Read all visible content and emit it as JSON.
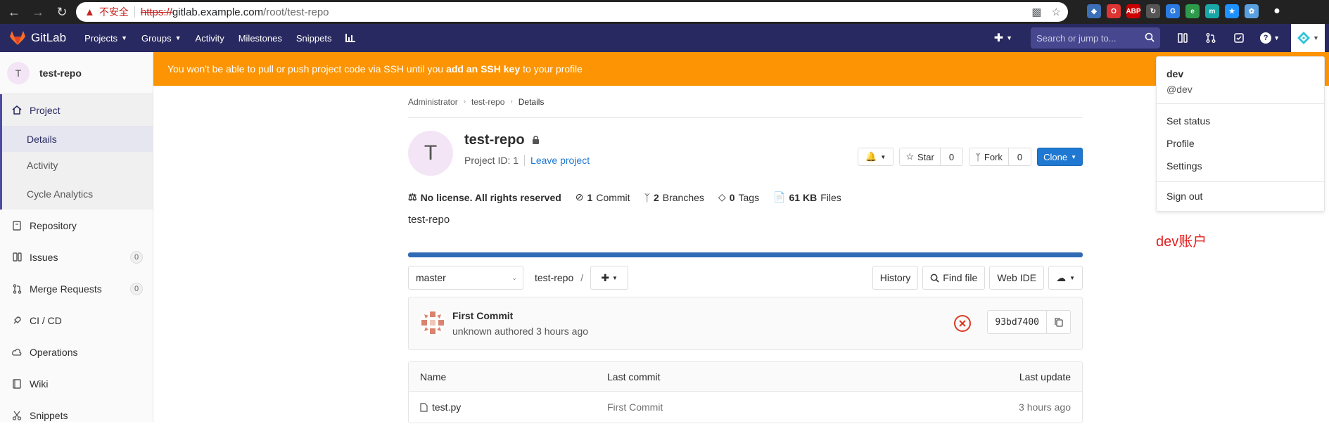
{
  "browser": {
    "insecure_label": "不安全",
    "url_scheme": "https://",
    "url_host": "gitlab.example.com",
    "url_path": "/root/test-repo"
  },
  "topnav": {
    "logo_text": "GitLab",
    "menu": [
      "Projects",
      "Groups",
      "Activity",
      "Milestones",
      "Snippets"
    ],
    "search_placeholder": "Search or jump to...",
    "brand_color": "#292961"
  },
  "banner": {
    "text_before": "You won't be able to pull or push project code via SSH until you",
    "link": "add an SSH key",
    "text_after": "to your profile",
    "color": "#fc9403"
  },
  "sidebar": {
    "project_initial": "T",
    "project_name": "test-repo",
    "section": "Project",
    "sub_items": [
      "Details",
      "Activity",
      "Cycle Analytics"
    ],
    "items": [
      {
        "label": "Repository"
      },
      {
        "label": "Issues",
        "count": "0"
      },
      {
        "label": "Merge Requests",
        "count": "0"
      },
      {
        "label": "CI / CD"
      },
      {
        "label": "Operations"
      },
      {
        "label": "Wiki"
      },
      {
        "label": "Snippets"
      }
    ]
  },
  "breadcrumb": [
    "Administrator",
    "test-repo",
    "Details"
  ],
  "project": {
    "initial": "T",
    "title": "test-repo",
    "project_id": "Project ID: 1",
    "leave": "Leave project",
    "star_label": "Star",
    "star_count": "0",
    "fork_label": "Fork",
    "fork_count": "0",
    "clone_label": "Clone",
    "description": "test-repo"
  },
  "stats": {
    "license": "No license. All rights reserved",
    "commits_n": "1",
    "commits_label": "Commit",
    "branches_n": "2",
    "branches_label": "Branches",
    "tags_n": "0",
    "tags_label": "Tags",
    "files_size": "61 KB",
    "files_label": "Files"
  },
  "toolbar": {
    "branch": "master",
    "path": "test-repo",
    "path_sep": "/",
    "history": "History",
    "find_file": "Find file",
    "web_ide": "Web IDE"
  },
  "commit": {
    "title": "First Commit",
    "meta": "unknown authored 3 hours ago",
    "sha": "93bd7400"
  },
  "files": {
    "headers": [
      "Name",
      "Last commit",
      "Last update"
    ],
    "rows": [
      {
        "name": "test.py",
        "last_commit": "First Commit",
        "last_update": "3 hours ago"
      }
    ]
  },
  "user_dropdown": {
    "name": "dev",
    "handle": "@dev",
    "items": [
      "Set status",
      "Profile",
      "Settings"
    ],
    "sign_out": "Sign out"
  },
  "annotation": "dev账户"
}
